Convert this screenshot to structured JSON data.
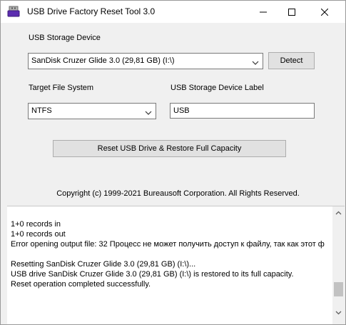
{
  "window": {
    "title": "USB Drive Factory Reset Tool 3.0",
    "icon": "usb-drive-app-icon"
  },
  "device": {
    "label": "USB Storage Device",
    "selected": "SanDisk Cruzer Glide 3.0 (29,81 GB) (I:\\)",
    "detect_label": "Detect"
  },
  "filesystem": {
    "label": "Target File System",
    "selected": "NTFS"
  },
  "volume_label": {
    "label": "USB Storage Device Label",
    "value": "USB"
  },
  "reset_button_label": "Reset USB Drive & Restore Full Capacity",
  "copyright": "Copyright (c) 1999-2021 Bureausoft Corporation. All Rights Reserved.",
  "log": {
    "lines": [
      "1+0 records in",
      "1+0 records out",
      "Error opening output file: 32 Процесс не может получить доступ к файлу, так как этот ф",
      "",
      "Resetting SanDisk Cruzer Glide 3.0 (29,81 GB) (I:\\)...",
      "USB drive SanDisk Cruzer Glide 3.0 (29,81 GB) (I:\\) is restored to its full capacity.",
      "Reset operation completed successfully."
    ]
  },
  "colors": {
    "window_bg": "#f0f0f0",
    "titlebar_bg": "#ffffff",
    "button_bg": "#e1e1e1",
    "button_border": "#adadad",
    "field_border": "#7a7a7a"
  }
}
